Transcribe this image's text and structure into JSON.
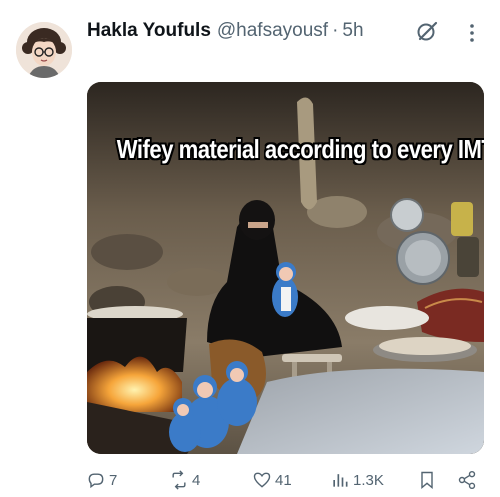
{
  "author": {
    "display_name": "Hakla Youfuls",
    "handle": "@hafsayousf",
    "separator": "·",
    "time": "5h"
  },
  "media": {
    "caption": "Wifey material according to every IMT man"
  },
  "actions": {
    "replies": "7",
    "reposts": "4",
    "likes": "41",
    "views": "1.3K"
  },
  "icons": {
    "grok": "grok-icon",
    "more": "more-vertical-icon",
    "reply": "reply-icon",
    "repost": "repost-icon",
    "like": "heart-icon",
    "views": "views-icon",
    "bookmark": "bookmark-icon",
    "share": "share-icon"
  },
  "colors": {
    "text_primary": "#0f1419",
    "text_secondary": "#536471"
  }
}
